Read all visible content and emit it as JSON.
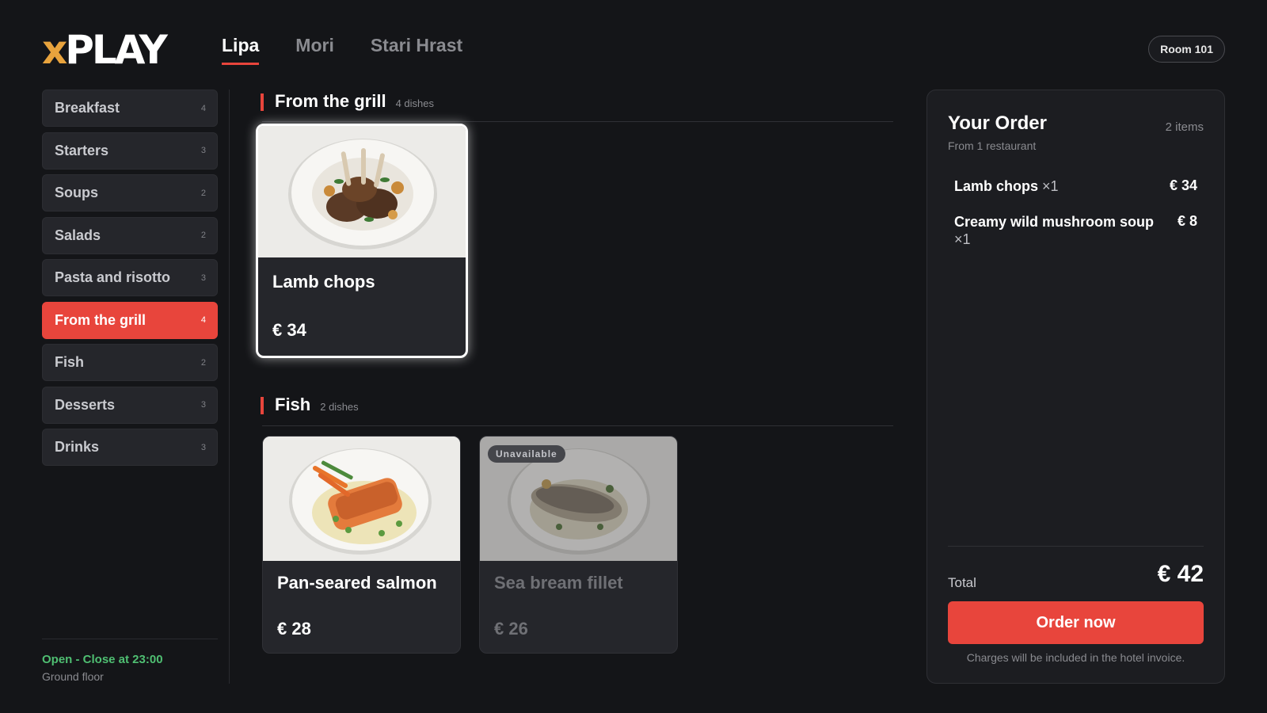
{
  "brand": {
    "logo_prefix": "x",
    "logo_main": "PLAY",
    "accent": "#e8453c",
    "logo_accent": "#e8a33d"
  },
  "tabs": [
    {
      "label": "Lipa",
      "active": true
    },
    {
      "label": "Mori",
      "active": false
    },
    {
      "label": "Stari Hrast",
      "active": false
    }
  ],
  "room": "Room 101",
  "categories": [
    {
      "label": "Breakfast",
      "count": "4"
    },
    {
      "label": "Starters",
      "count": "3"
    },
    {
      "label": "Soups",
      "count": "2"
    },
    {
      "label": "Salads",
      "count": "2"
    },
    {
      "label": "Pasta and risotto",
      "count": "3"
    },
    {
      "label": "From the grill",
      "count": "4",
      "active": true
    },
    {
      "label": "Fish",
      "count": "2"
    },
    {
      "label": "Desserts",
      "count": "3"
    },
    {
      "label": "Drinks",
      "count": "3"
    }
  ],
  "venue": {
    "status": "Open - Close at 23:00",
    "location": "Ground floor",
    "status_color": "#4fbf72"
  },
  "sections": [
    {
      "title": "From the grill",
      "count": "4 dishes",
      "dishes": [
        {
          "name": "Lamb chops",
          "price": "€ 34",
          "selected": true,
          "available": true,
          "photo_icon": "lamb-chops-plate"
        }
      ]
    },
    {
      "title": "Fish",
      "count": "2 dishes",
      "dishes": [
        {
          "name": "Pan-seared salmon",
          "price": "€ 28",
          "available": true,
          "photo_icon": "salmon-plate"
        },
        {
          "name": "Sea bream fillet",
          "price": "€ 26",
          "available": false,
          "badge": "Unavailable",
          "photo_icon": "sea-bream-plate"
        }
      ]
    }
  ],
  "order": {
    "title": "Your Order",
    "items_count": "2 items",
    "subtitle": "From 1 restaurant",
    "lines": [
      {
        "name": "Lamb chops",
        "qty": "×1",
        "amount": "€ 34"
      },
      {
        "name": "Creamy wild mushroom soup",
        "qty": "×1",
        "amount": "€ 8"
      }
    ],
    "total_label": "Total",
    "total": "€ 42",
    "button": "Order now",
    "note": "Charges will be included in the hotel invoice."
  }
}
